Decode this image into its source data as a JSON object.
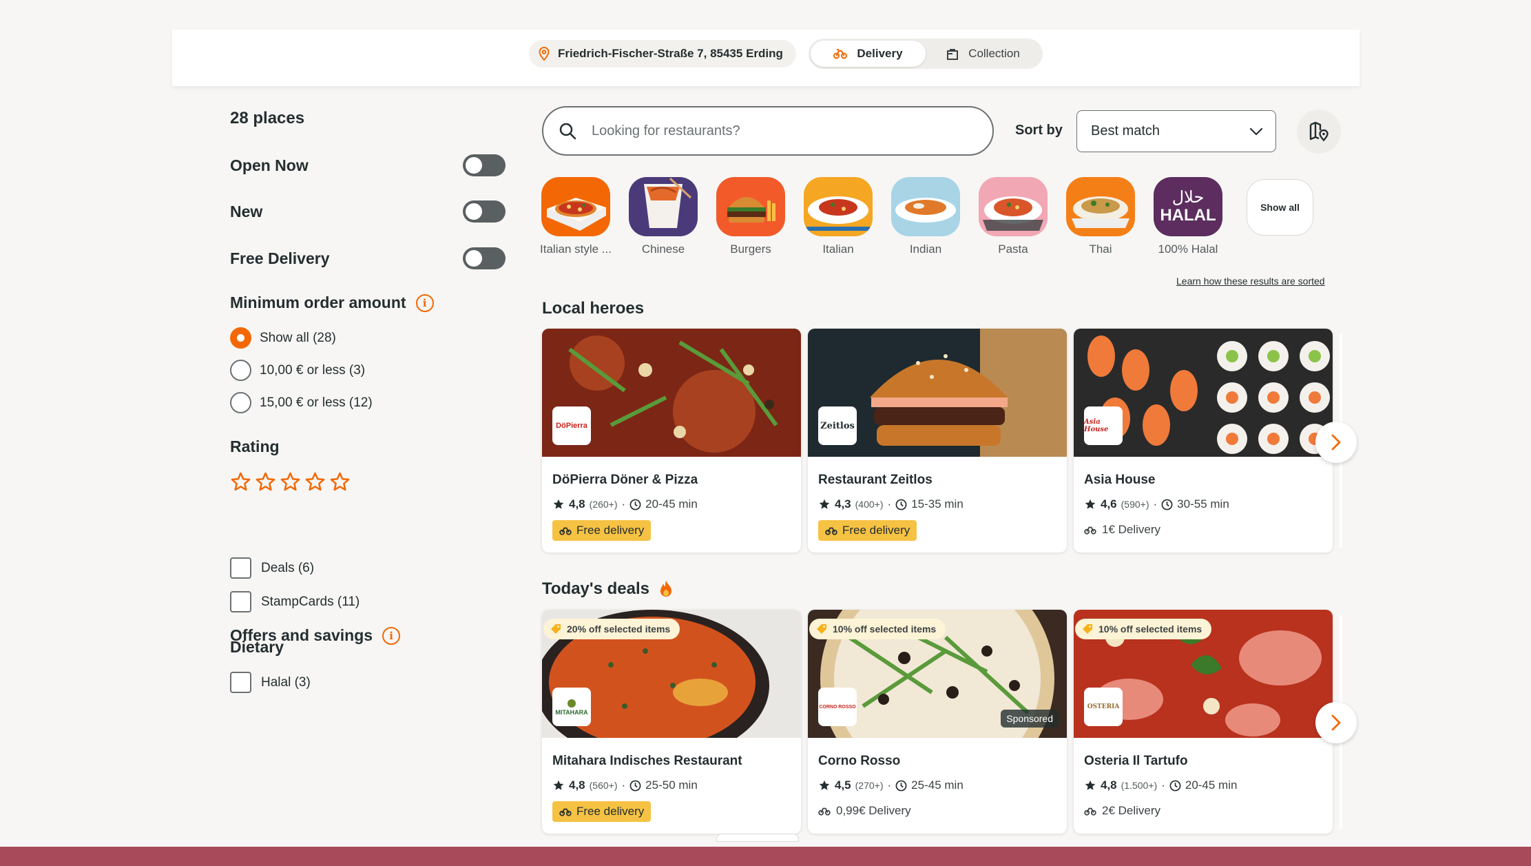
{
  "header": {
    "address": "Friedrich-Fischer-Straße 7, 85435 Erding",
    "modes": [
      {
        "label": "Delivery",
        "active": true,
        "icon": "bike-icon"
      },
      {
        "label": "Collection",
        "active": false,
        "icon": "shop-bag-icon"
      }
    ]
  },
  "sidebar": {
    "places_count": "28 places",
    "toggles": [
      {
        "label": "Open Now",
        "on": false
      },
      {
        "label": "New",
        "on": false
      },
      {
        "label": "Free Delivery",
        "on": false
      }
    ],
    "min_order": {
      "title": "Minimum order amount",
      "info_icon": "i",
      "options": [
        {
          "label": "Show all (28)",
          "checked": true
        },
        {
          "label": "10,00 € or less (3)",
          "checked": false
        },
        {
          "label": "15,00 € or less (12)",
          "checked": false
        }
      ]
    },
    "rating": {
      "title": "Rating",
      "stars": 5
    },
    "offers": {
      "title": "Offers and savings",
      "info_icon": "i",
      "options": [
        {
          "label": "Deals (6)",
          "checked": false
        },
        {
          "label": "StampCards (11)",
          "checked": false
        }
      ]
    },
    "dietary": {
      "title": "Dietary",
      "options": [
        {
          "label": "Halal (3)",
          "checked": false
        }
      ]
    }
  },
  "search": {
    "placeholder": "Looking for restaurants?",
    "value": ""
  },
  "sort": {
    "label": "Sort by",
    "selected": "Best match"
  },
  "cuisines": [
    {
      "label": "Italian style ...",
      "bg": "#f36805"
    },
    {
      "label": "Chinese",
      "bg": "#4b3a7a"
    },
    {
      "label": "Burgers",
      "bg": "#f25a2a"
    },
    {
      "label": "Italian",
      "bg": "#f5a623"
    },
    {
      "label": "Indian",
      "bg": "#a8d4e6"
    },
    {
      "label": "Pasta",
      "bg": "#f2a7b5"
    },
    {
      "label": "Thai",
      "bg": "#f57f17"
    },
    {
      "label": "100% Halal",
      "bg": "#5c2d5e",
      "badge_text": "HALAL",
      "badge_arabic": "حلال"
    }
  ],
  "show_all_label": "Show all",
  "learn_link": "Learn how these results are sorted",
  "local_heroes": {
    "title": "Local heroes",
    "cards": [
      {
        "name": "DöPierra Döner & Pizza",
        "rating": "4,8",
        "count": "(260+)",
        "time": "20-45 min",
        "badge": "Free delivery",
        "logo": "DöPierra"
      },
      {
        "name": "Restaurant Zeitlos",
        "rating": "4,3",
        "count": "(400+)",
        "time": "15-35 min",
        "badge": "Free delivery",
        "logo": "Zeitlos"
      },
      {
        "name": "Asia House",
        "rating": "4,6",
        "count": "(590+)",
        "time": "30-55 min",
        "fee": "1€ Delivery",
        "logo": "Asia House"
      }
    ]
  },
  "todays_deals": {
    "title": "Today's deals",
    "cards": [
      {
        "name": "Mitahara Indisches Restaurant",
        "deal": "20% off selected items",
        "rating": "4,8",
        "count": "(560+)",
        "time": "25-50 min",
        "badge": "Free delivery",
        "logo": "MITAHARA"
      },
      {
        "name": "Corno Rosso",
        "deal": "10% off selected items",
        "rating": "4,5",
        "count": "(270+)",
        "time": "25-45 min",
        "fee": "0,99€ Delivery",
        "logo": "CORNO ROSSO",
        "sponsored": "Sponsored"
      },
      {
        "name": "Osteria Il Tartufo",
        "deal": "10% off selected items",
        "rating": "4,8",
        "count": "(1.500+)",
        "time": "20-45 min",
        "fee": "2€ Delivery",
        "logo": "OSTERIA"
      }
    ]
  },
  "colors": {
    "accent": "#f36805",
    "badge": "#f6c243",
    "deal_tag": "#fdf3d6",
    "bottom_bar": "#a84a5a"
  }
}
